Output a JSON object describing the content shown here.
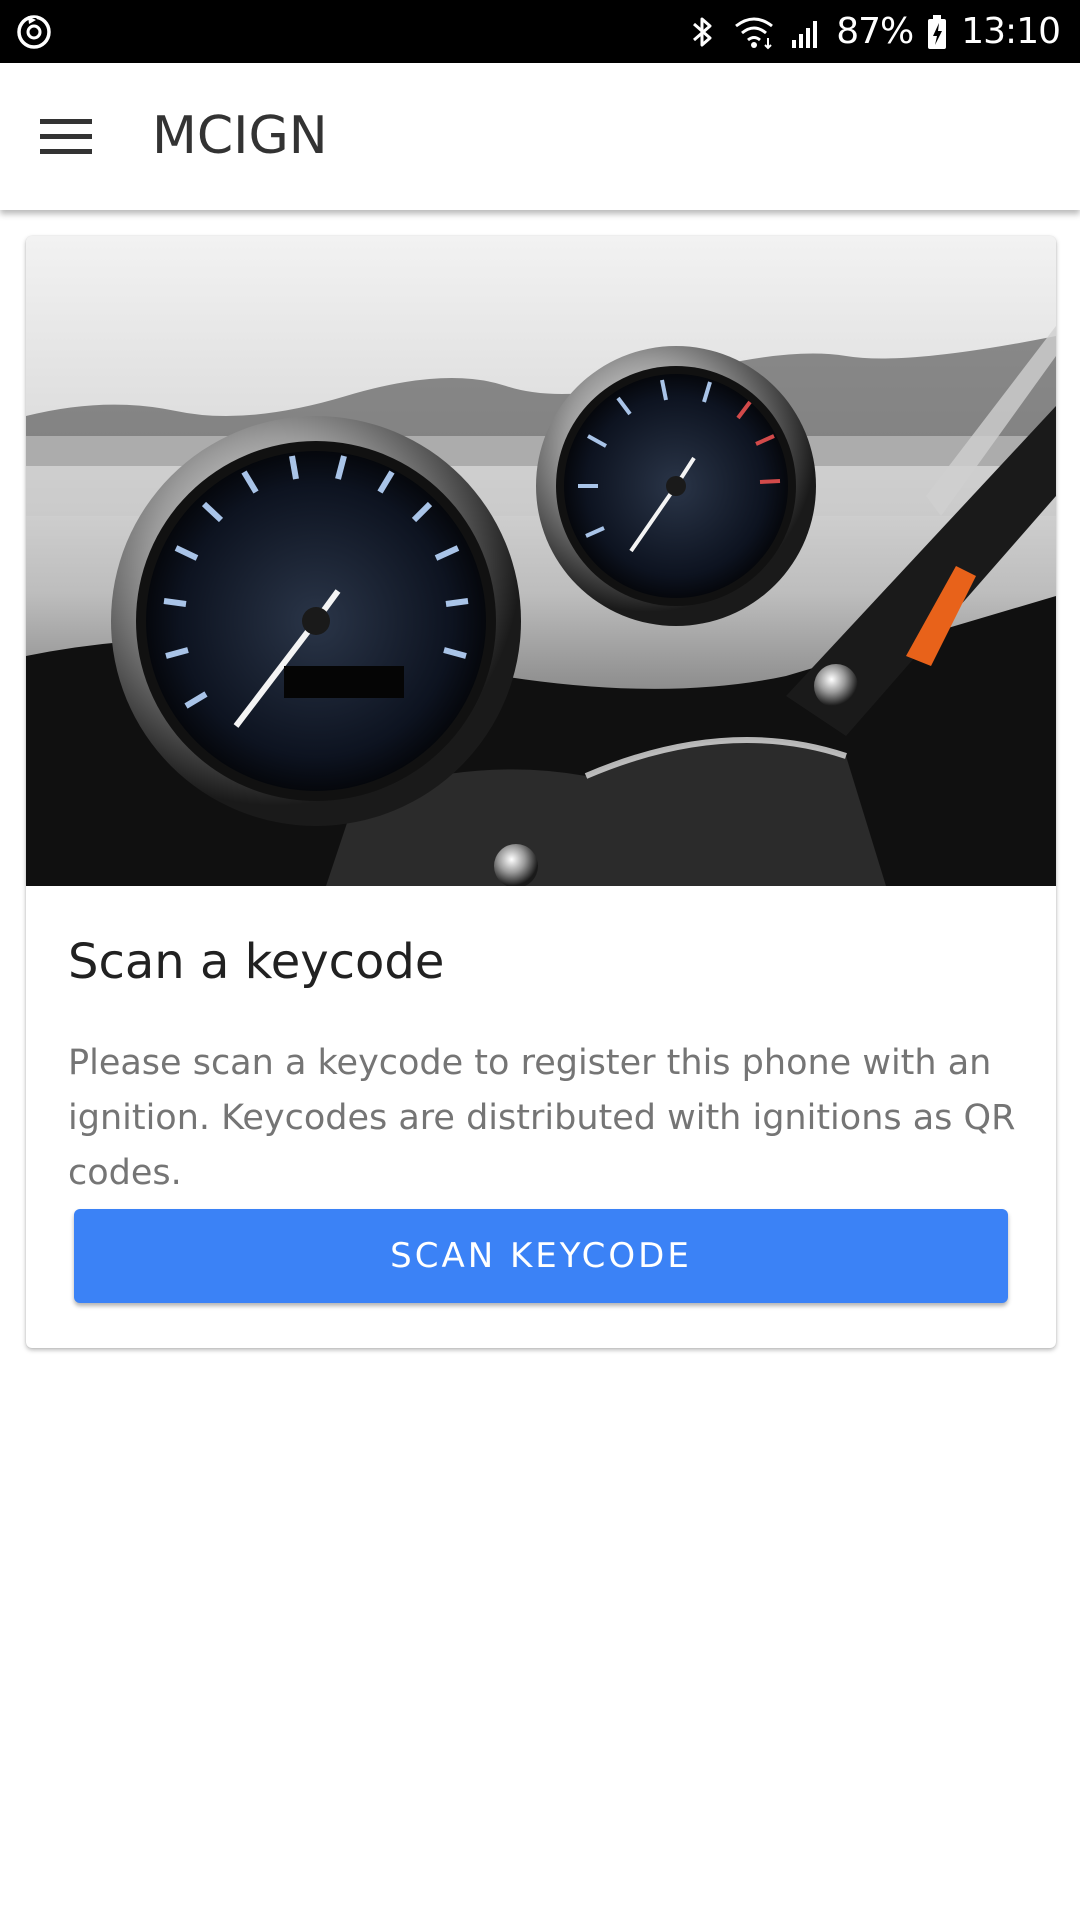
{
  "status_bar": {
    "left_icon": "sync-icon",
    "icons": [
      "bluetooth-icon",
      "wifi-icon",
      "signal-icon"
    ],
    "battery_percent": "87%",
    "battery_icon": "battery-charging-icon",
    "time": "13:10"
  },
  "app_bar": {
    "menu_icon": "hamburger-menu-icon",
    "title": "MCIGN"
  },
  "card": {
    "image_description_icon": "speedometer-image",
    "title": "Scan a keycode",
    "text": "Please scan a keycode to register this phone with an ignition. Keycodes are distributed with ignitions as QR codes.",
    "button_label": "SCAN KEYCODE"
  },
  "colors": {
    "status_bar_bg": "#000000",
    "app_bar_bg": "#ffffff",
    "title_text": "#333333",
    "body_text": "#757575",
    "button_bg": "#3b82f6",
    "button_text": "#ffffff"
  }
}
